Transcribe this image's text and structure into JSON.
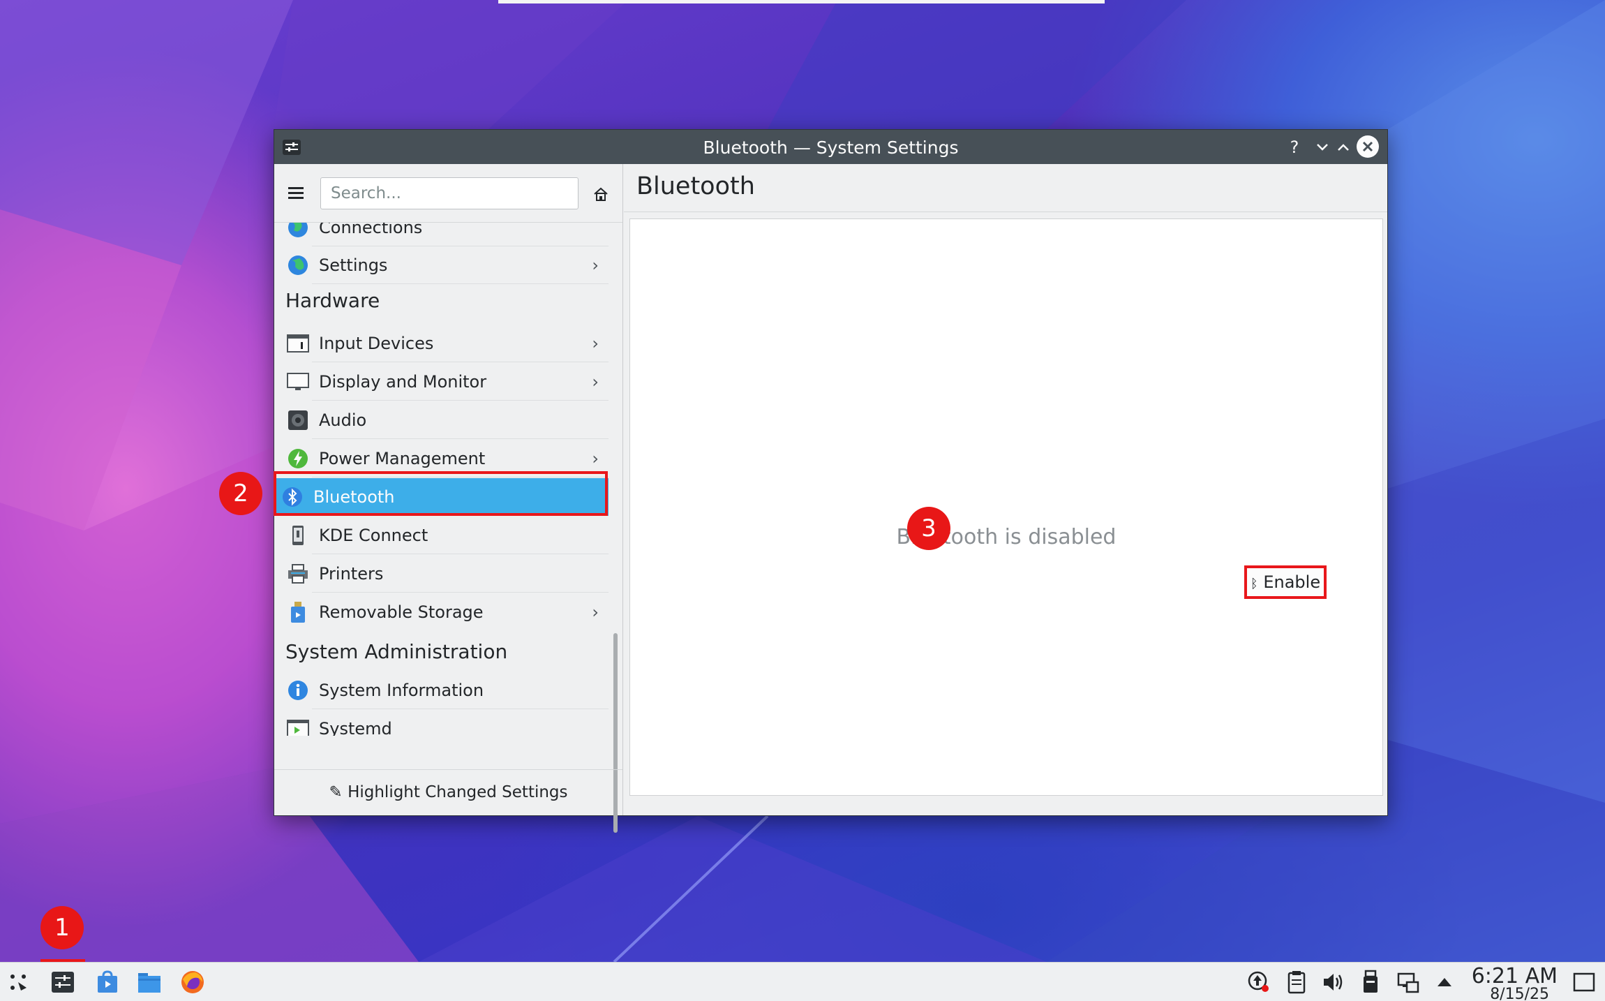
{
  "window": {
    "title": "Bluetooth — System Settings"
  },
  "sidebar": {
    "search_placeholder": "Search...",
    "items": [
      {
        "label": "Connections"
      },
      {
        "label": "Settings"
      },
      {
        "label": "Input Devices"
      },
      {
        "label": "Display and Monitor"
      },
      {
        "label": "Audio"
      },
      {
        "label": "Power Management"
      },
      {
        "label": "Bluetooth"
      },
      {
        "label": "KDE Connect"
      },
      {
        "label": "Printers"
      },
      {
        "label": "Removable Storage"
      },
      {
        "label": "System Information"
      },
      {
        "label": "Systemd"
      }
    ],
    "categories": [
      "Hardware",
      "System Administration"
    ],
    "footer_button": "Highlight Changed Settings"
  },
  "main": {
    "heading": "Bluetooth",
    "disabled_message": "Bluetooth is disabled",
    "enable_button": "Enable"
  },
  "annotations": [
    "1",
    "2",
    "3"
  ],
  "taskbar": {
    "time": "6:21 AM",
    "date": "8/15/25"
  },
  "colors": {
    "accent": "#3daee9",
    "annotation_red": "#e8171b",
    "titlebar": "#475057"
  }
}
